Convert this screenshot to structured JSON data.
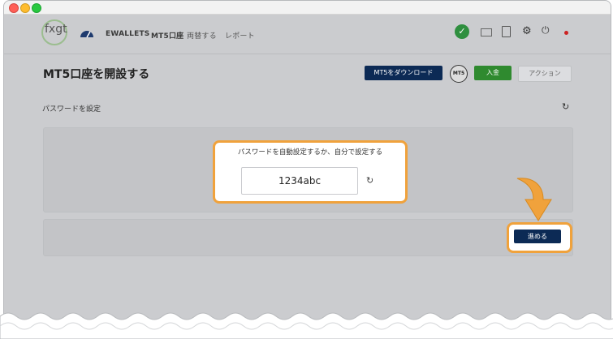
{
  "nav": {
    "logo": "fxgt",
    "items": [
      "EWALLETS",
      "MT5口座",
      "両替する",
      "レポート"
    ]
  },
  "header": {
    "title": "MT5口座を開設する",
    "download_button": "MT5をダウンロード",
    "mt5_badge": "MT5",
    "deposit_button": "入金",
    "action_button": "アクション"
  },
  "section": {
    "label": "パスワードを設定"
  },
  "password": {
    "prompt": "パスワードを自動設定するか、自分で設定する",
    "value": "1234abc"
  },
  "footer": {
    "next_button": "進める"
  },
  "colors": {
    "highlight": "#f0a23c",
    "primary_button": "#0c2a55",
    "deposit_green": "#2f8a2f",
    "check_green": "#2f8f3f"
  },
  "icons": [
    "speedometer-icon",
    "check-icon",
    "mail-icon",
    "clipboard-icon",
    "gear-icon",
    "power-icon",
    "flag-icon",
    "refresh-icon",
    "arrow-down-icon"
  ]
}
